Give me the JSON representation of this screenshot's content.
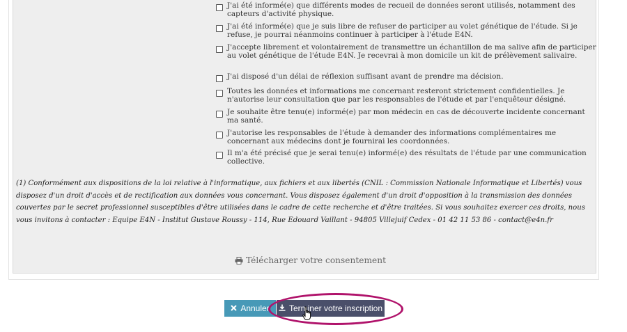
{
  "consents": [
    {
      "text": "J'ai été informé(e) que différents modes de recueil de données seront utilisés, notamment des capteurs d'activité physique."
    },
    {
      "text": "J'ai été informé(e) que je suis libre de refuser de participer au volet génétique de l'étude. Si je refuse, je pourrai néanmoins continuer à participer à l'étude E4N."
    },
    {
      "text": "J'accepte librement et volontairement de transmettre un échantillon de ma salive afin de participer au volet génétique de l'étude E4N. Je recevrai à mon domicile un kit de prélèvement salivaire."
    },
    {
      "text": "J'ai disposé d'un délai de réflexion suffisant avant de prendre ma décision."
    },
    {
      "text": "Toutes les données et informations me concernant resteront strictement confidentielles. Je n'autorise leur consultation que par les responsables de l'étude et par l'enquêteur désigné."
    },
    {
      "text": "Je souhaite être tenu(e) informé(e) par mon médecin en cas de découverte incidente concernant ma santé."
    },
    {
      "text": "J'autorise les responsables de l'étude à demander des informations complémentaires me concernant aux médecins dont je fournirai les coordonnées."
    },
    {
      "text": "Il m'a été précisé que je serai tenu(e) informé(e) des résultats de l'étude par une communication collective."
    }
  ],
  "footnote": "(1) Conformément aux dispositions de la loi relative à l'informatique, aux fichiers et aux libertés (CNIL : Commission Nationale Informatique et Libertés) vous disposez d'un droit d'accès et de rectification aux données vous concernant. Vous disposez également d'un droit d'opposition à la transmission des données couvertes par le secret professionnel susceptibles d'être utilisées dans le cadre de cette recherche et d'être traitées. Si vous souhaitez exercer ces droits, nous vous invitons à contacter : Equipe E4N - Institut Gustave Roussy - 114, Rue Edouard Vaillant - 94805 Villejuif Cedex - 01 42 11 53 86 - contact@e4n.fr",
  "download": {
    "label": "Télécharger votre consentement",
    "icon": "printer-icon"
  },
  "actions": {
    "cancel_label": "Annuler",
    "cancel_icon": "close-icon",
    "finish_label": "Terminer votre inscription",
    "finish_icon": "download-icon"
  },
  "colors": {
    "cancel": "#4799b7",
    "finish": "#4a4f6a",
    "highlight": "#b0136b",
    "panel": "#eeeeee"
  }
}
